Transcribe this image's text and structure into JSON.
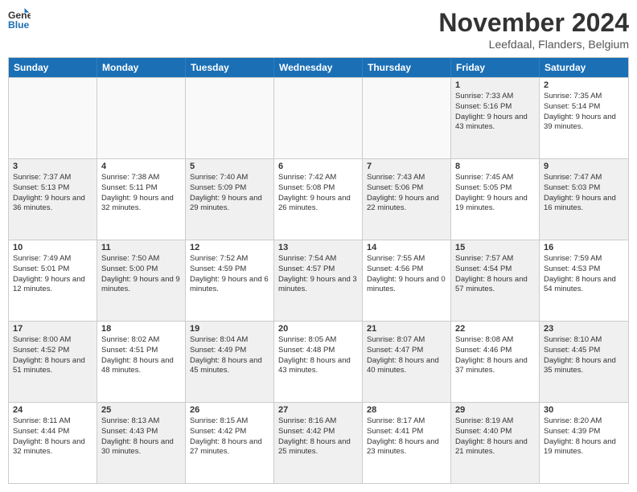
{
  "header": {
    "logo_line1": "General",
    "logo_line2": "Blue",
    "month": "November 2024",
    "location": "Leefdaal, Flanders, Belgium"
  },
  "days_of_week": [
    "Sunday",
    "Monday",
    "Tuesday",
    "Wednesday",
    "Thursday",
    "Friday",
    "Saturday"
  ],
  "weeks": [
    [
      {
        "day": "",
        "info": "",
        "empty": true
      },
      {
        "day": "",
        "info": "",
        "empty": true
      },
      {
        "day": "",
        "info": "",
        "empty": true
      },
      {
        "day": "",
        "info": "",
        "empty": true
      },
      {
        "day": "",
        "info": "",
        "empty": true
      },
      {
        "day": "1",
        "info": "Sunrise: 7:33 AM\nSunset: 5:16 PM\nDaylight: 9 hours and 43 minutes.",
        "shaded": true
      },
      {
        "day": "2",
        "info": "Sunrise: 7:35 AM\nSunset: 5:14 PM\nDaylight: 9 hours and 39 minutes.",
        "shaded": false
      }
    ],
    [
      {
        "day": "3",
        "info": "Sunrise: 7:37 AM\nSunset: 5:13 PM\nDaylight: 9 hours and 36 minutes.",
        "shaded": true
      },
      {
        "day": "4",
        "info": "Sunrise: 7:38 AM\nSunset: 5:11 PM\nDaylight: 9 hours and 32 minutes.",
        "shaded": false
      },
      {
        "day": "5",
        "info": "Sunrise: 7:40 AM\nSunset: 5:09 PM\nDaylight: 9 hours and 29 minutes.",
        "shaded": true
      },
      {
        "day": "6",
        "info": "Sunrise: 7:42 AM\nSunset: 5:08 PM\nDaylight: 9 hours and 26 minutes.",
        "shaded": false
      },
      {
        "day": "7",
        "info": "Sunrise: 7:43 AM\nSunset: 5:06 PM\nDaylight: 9 hours and 22 minutes.",
        "shaded": true
      },
      {
        "day": "8",
        "info": "Sunrise: 7:45 AM\nSunset: 5:05 PM\nDaylight: 9 hours and 19 minutes.",
        "shaded": false
      },
      {
        "day": "9",
        "info": "Sunrise: 7:47 AM\nSunset: 5:03 PM\nDaylight: 9 hours and 16 minutes.",
        "shaded": true
      }
    ],
    [
      {
        "day": "10",
        "info": "Sunrise: 7:49 AM\nSunset: 5:01 PM\nDaylight: 9 hours and 12 minutes.",
        "shaded": false
      },
      {
        "day": "11",
        "info": "Sunrise: 7:50 AM\nSunset: 5:00 PM\nDaylight: 9 hours and 9 minutes.",
        "shaded": true
      },
      {
        "day": "12",
        "info": "Sunrise: 7:52 AM\nSunset: 4:59 PM\nDaylight: 9 hours and 6 minutes.",
        "shaded": false
      },
      {
        "day": "13",
        "info": "Sunrise: 7:54 AM\nSunset: 4:57 PM\nDaylight: 9 hours and 3 minutes.",
        "shaded": true
      },
      {
        "day": "14",
        "info": "Sunrise: 7:55 AM\nSunset: 4:56 PM\nDaylight: 9 hours and 0 minutes.",
        "shaded": false
      },
      {
        "day": "15",
        "info": "Sunrise: 7:57 AM\nSunset: 4:54 PM\nDaylight: 8 hours and 57 minutes.",
        "shaded": true
      },
      {
        "day": "16",
        "info": "Sunrise: 7:59 AM\nSunset: 4:53 PM\nDaylight: 8 hours and 54 minutes.",
        "shaded": false
      }
    ],
    [
      {
        "day": "17",
        "info": "Sunrise: 8:00 AM\nSunset: 4:52 PM\nDaylight: 8 hours and 51 minutes.",
        "shaded": true
      },
      {
        "day": "18",
        "info": "Sunrise: 8:02 AM\nSunset: 4:51 PM\nDaylight: 8 hours and 48 minutes.",
        "shaded": false
      },
      {
        "day": "19",
        "info": "Sunrise: 8:04 AM\nSunset: 4:49 PM\nDaylight: 8 hours and 45 minutes.",
        "shaded": true
      },
      {
        "day": "20",
        "info": "Sunrise: 8:05 AM\nSunset: 4:48 PM\nDaylight: 8 hours and 43 minutes.",
        "shaded": false
      },
      {
        "day": "21",
        "info": "Sunrise: 8:07 AM\nSunset: 4:47 PM\nDaylight: 8 hours and 40 minutes.",
        "shaded": true
      },
      {
        "day": "22",
        "info": "Sunrise: 8:08 AM\nSunset: 4:46 PM\nDaylight: 8 hours and 37 minutes.",
        "shaded": false
      },
      {
        "day": "23",
        "info": "Sunrise: 8:10 AM\nSunset: 4:45 PM\nDaylight: 8 hours and 35 minutes.",
        "shaded": true
      }
    ],
    [
      {
        "day": "24",
        "info": "Sunrise: 8:11 AM\nSunset: 4:44 PM\nDaylight: 8 hours and 32 minutes.",
        "shaded": false
      },
      {
        "day": "25",
        "info": "Sunrise: 8:13 AM\nSunset: 4:43 PM\nDaylight: 8 hours and 30 minutes.",
        "shaded": true
      },
      {
        "day": "26",
        "info": "Sunrise: 8:15 AM\nSunset: 4:42 PM\nDaylight: 8 hours and 27 minutes.",
        "shaded": false
      },
      {
        "day": "27",
        "info": "Sunrise: 8:16 AM\nSunset: 4:42 PM\nDaylight: 8 hours and 25 minutes.",
        "shaded": true
      },
      {
        "day": "28",
        "info": "Sunrise: 8:17 AM\nSunset: 4:41 PM\nDaylight: 8 hours and 23 minutes.",
        "shaded": false
      },
      {
        "day": "29",
        "info": "Sunrise: 8:19 AM\nSunset: 4:40 PM\nDaylight: 8 hours and 21 minutes.",
        "shaded": true
      },
      {
        "day": "30",
        "info": "Sunrise: 8:20 AM\nSunset: 4:39 PM\nDaylight: 8 hours and 19 minutes.",
        "shaded": false
      }
    ]
  ]
}
